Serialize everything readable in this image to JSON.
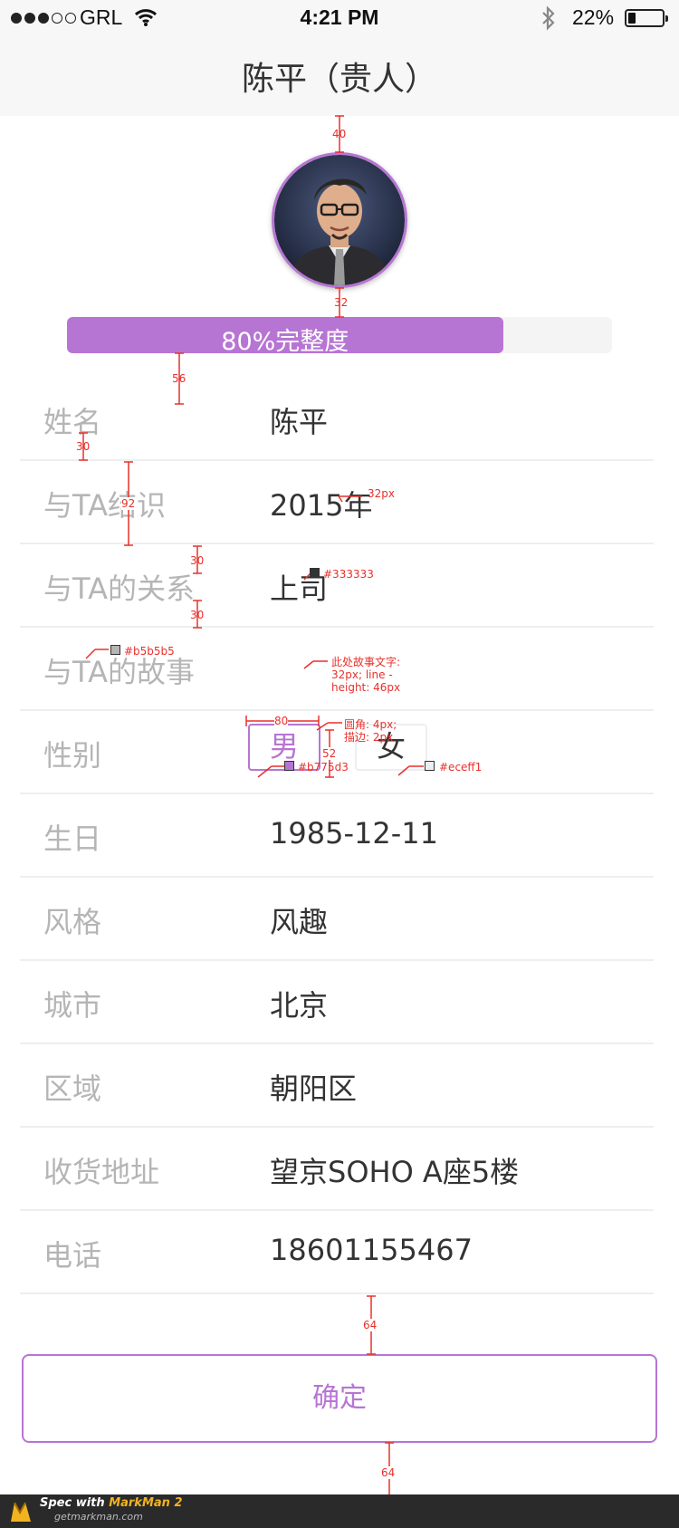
{
  "status_bar": {
    "carrier": "GRL",
    "time": "4:21 PM",
    "battery": "22%",
    "battery_level": 0.22
  },
  "nav": {
    "title": "陈平（贵人）"
  },
  "profile": {
    "completeness_label": "80%完整度",
    "completeness": 0.8
  },
  "rows": [
    {
      "label": "姓名",
      "value": "陈平"
    },
    {
      "label": "与TA结识",
      "value": "2015年"
    },
    {
      "label": "与TA的关系",
      "value": "上司"
    },
    {
      "label": "与TA的故事",
      "value": ""
    },
    {
      "label": "性别",
      "options": [
        "男",
        "女"
      ],
      "selected": "男"
    },
    {
      "label": "生日",
      "value": "1985-12-11"
    },
    {
      "label": "风格",
      "value": "风趣"
    },
    {
      "label": "城市",
      "value": "北京"
    },
    {
      "label": "区域",
      "value": "朝阳区"
    },
    {
      "label": "收货地址",
      "value": "望京SOHO A座5楼"
    },
    {
      "label": "电话",
      "value": "18601155467"
    }
  ],
  "confirm_label": "确定",
  "spec": {
    "avatar_top": "40",
    "avatar_bottom": "32",
    "progress_gap": "56",
    "label_gap": "30",
    "row_height": "92",
    "font_size": "32px",
    "value_color": "#333333",
    "relation_gap_top": "30",
    "relation_gap_bottom": "30",
    "label_color": "#b5b5b5",
    "story_note_1": "此处故事文字:",
    "story_note_2": "32px;  line -",
    "story_note_3": "height: 46px",
    "gender_width": "80",
    "gender_radius": "圆角: 4px;",
    "gender_stroke": "描边: 2px",
    "gender_height": "52",
    "selected_color": "#b775d3",
    "unselected_color": "#eceff1",
    "confirm_top": "64",
    "confirm_bottom": "64"
  },
  "footer": {
    "prefix": "Spec with ",
    "brand": "MarkMan 2",
    "url": "getmarkman.com"
  }
}
